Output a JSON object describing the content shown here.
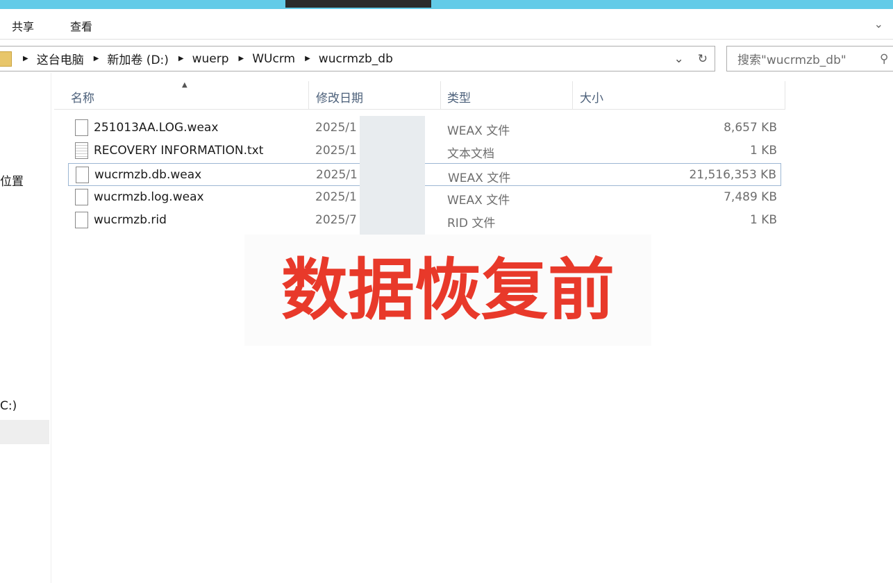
{
  "ribbon": {
    "share": "共享",
    "view": "查看"
  },
  "address": {
    "crumbs": [
      "这台电脑",
      "新加卷 (D:)",
      "wuerp",
      "WUcrm",
      "wucrmzb_db"
    ]
  },
  "search": {
    "placeholder": "搜索\"wucrmzb_db\""
  },
  "sidebar": {
    "items": [
      "位置",
      "C:)"
    ]
  },
  "columns": {
    "name": "名称",
    "date": "修改日期",
    "type": "类型",
    "size": "大小"
  },
  "files": [
    {
      "name": "251013AA.LOG.weax",
      "date": "2025/1",
      "type": "WEAX 文件",
      "size": "8,657 KB"
    },
    {
      "name": "RECOVERY INFORMATION.txt",
      "date": "2025/1",
      "type": "文本文档",
      "size": "1 KB"
    },
    {
      "name": "wucrmzb.db.weax",
      "date": "2025/1",
      "type": "WEAX 文件",
      "size": "21,516,353 KB"
    },
    {
      "name": "wucrmzb.log.weax",
      "date": "2025/1",
      "type": "WEAX 文件",
      "size": "7,489 KB"
    },
    {
      "name": "wucrmzb.rid",
      "date": "2025/7",
      "type": "RID 文件",
      "size": "1 KB"
    }
  ],
  "overlay": "数据恢复前"
}
